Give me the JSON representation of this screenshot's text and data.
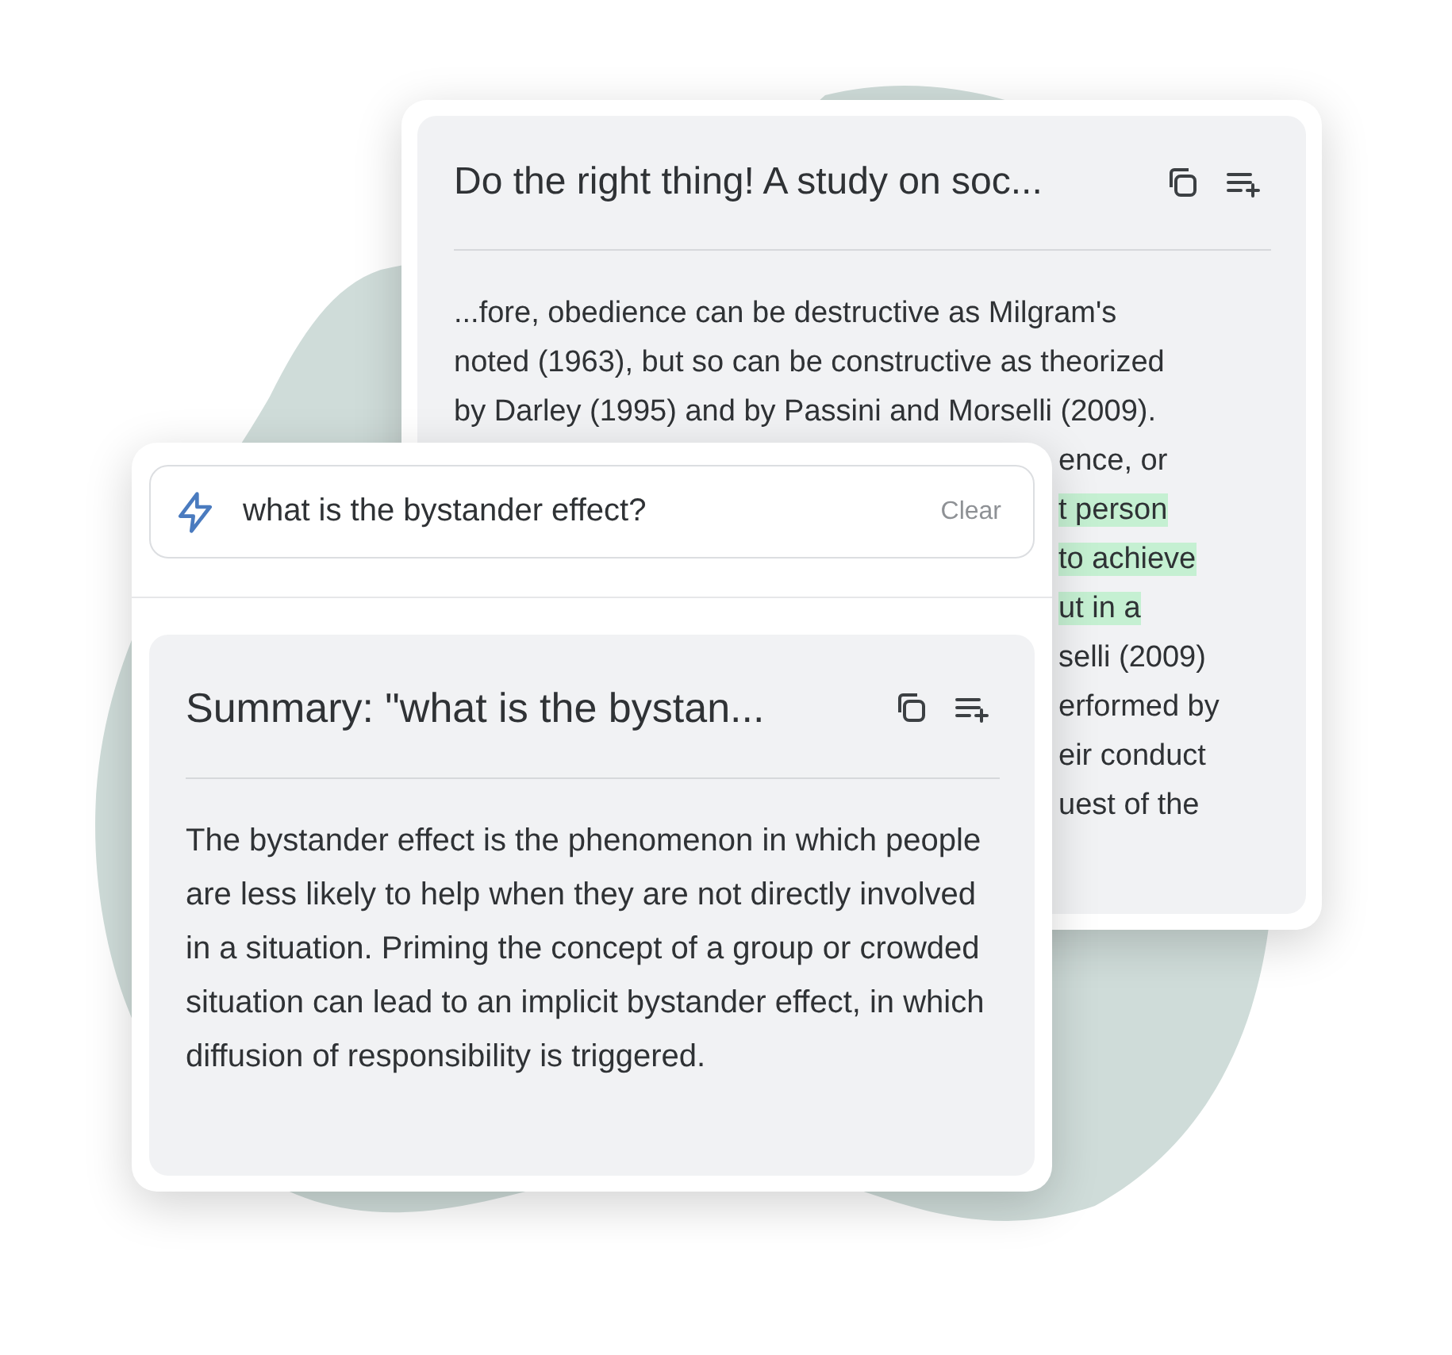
{
  "source_card": {
    "title": "Do the right thing! A study on soc...",
    "lines": [
      {
        "text": "...fore, obedience can be destructive as Milgram's",
        "highlighted": false
      },
      {
        "text": "noted (1963), but so can be constructive as theorized",
        "highlighted": false
      },
      {
        "text": "by Darley (1995) and by Passini and Morselli (2009).",
        "highlighted": false
      }
    ],
    "fragments": [
      {
        "text": "ence, or",
        "highlighted": false
      },
      {
        "text": "t person",
        "highlighted": true
      },
      {
        "text": "to achieve",
        "highlighted": true
      },
      {
        "text": "ut in a",
        "highlighted": true
      },
      {
        "text": "selli (2009)",
        "highlighted": false
      },
      {
        "text": "erformed by",
        "highlighted": false
      },
      {
        "text": "eir conduct",
        "highlighted": false
      },
      {
        "text": "uest of the",
        "highlighted": false
      }
    ]
  },
  "search": {
    "value": "what is the bystander effect?",
    "clear_label": "Clear"
  },
  "summary_card": {
    "title": "Summary: \"what is the bystan...",
    "body": "The bystander effect is the phenomenon in which people are less likely to help when they are not directly involved in a situation. Priming the concept of a group or crowded situation can lead to an implicit bystander effect, in which diffusion of responsibility is triggered."
  }
}
